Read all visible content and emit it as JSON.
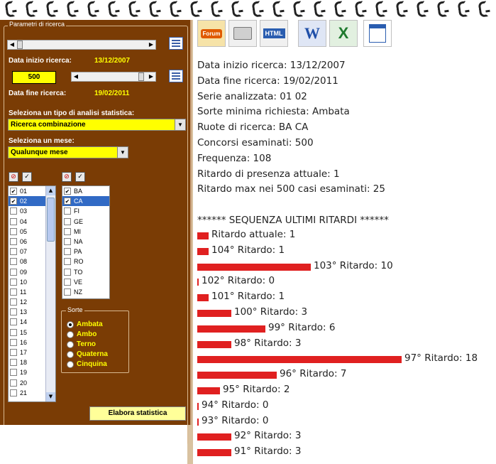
{
  "panel": {
    "legend": "Parametri di ricerca",
    "data_inizio_label": "Data inizio ricerca:",
    "data_inizio_value": "13/12/2007",
    "concorsi_value": "500",
    "data_fine_label": "Data fine ricerca:",
    "data_fine_value": "19/02/2011",
    "analisi_label": "Seleziona un tipo di analisi statistica:",
    "analisi_value": "Ricerca combinazione",
    "mese_label": "Seleziona un mese:",
    "mese_value": "Qualunque mese",
    "numbers": [
      {
        "label": "01",
        "checked": true,
        "selected": false
      },
      {
        "label": "02",
        "checked": true,
        "selected": true
      },
      {
        "label": "03",
        "checked": false,
        "selected": false
      },
      {
        "label": "04",
        "checked": false,
        "selected": false
      },
      {
        "label": "05",
        "checked": false,
        "selected": false
      },
      {
        "label": "06",
        "checked": false,
        "selected": false
      },
      {
        "label": "07",
        "checked": false,
        "selected": false
      },
      {
        "label": "08",
        "checked": false,
        "selected": false
      },
      {
        "label": "09",
        "checked": false,
        "selected": false
      },
      {
        "label": "10",
        "checked": false,
        "selected": false
      },
      {
        "label": "11",
        "checked": false,
        "selected": false
      },
      {
        "label": "12",
        "checked": false,
        "selected": false
      },
      {
        "label": "13",
        "checked": false,
        "selected": false
      },
      {
        "label": "14",
        "checked": false,
        "selected": false
      },
      {
        "label": "15",
        "checked": false,
        "selected": false
      },
      {
        "label": "16",
        "checked": false,
        "selected": false
      },
      {
        "label": "17",
        "checked": false,
        "selected": false
      },
      {
        "label": "18",
        "checked": false,
        "selected": false
      },
      {
        "label": "19",
        "checked": false,
        "selected": false
      },
      {
        "label": "20",
        "checked": false,
        "selected": false
      },
      {
        "label": "21",
        "checked": false,
        "selected": false
      }
    ],
    "ruote": [
      {
        "label": "BA",
        "checked": true,
        "selected": false
      },
      {
        "label": "CA",
        "checked": true,
        "selected": true
      },
      {
        "label": "FI",
        "checked": false,
        "selected": false
      },
      {
        "label": "GE",
        "checked": false,
        "selected": false
      },
      {
        "label": "MI",
        "checked": false,
        "selected": false
      },
      {
        "label": "NA",
        "checked": false,
        "selected": false
      },
      {
        "label": "PA",
        "checked": false,
        "selected": false
      },
      {
        "label": "RO",
        "checked": false,
        "selected": false
      },
      {
        "label": "TO",
        "checked": false,
        "selected": false
      },
      {
        "label": "VE",
        "checked": false,
        "selected": false
      },
      {
        "label": "NZ",
        "checked": false,
        "selected": false
      }
    ],
    "sorte_legend": "Sorte",
    "sorte": [
      {
        "label": "Ambata",
        "on": true
      },
      {
        "label": "Ambo",
        "on": false
      },
      {
        "label": "Terno",
        "on": false
      },
      {
        "label": "Quaterna",
        "on": false
      },
      {
        "label": "Cinquina",
        "on": false
      }
    ],
    "elabora_label": "Elabora statistica"
  },
  "toolbar": {
    "forum_label": "Forum",
    "html_label": "HTML",
    "word_label": "W",
    "excel_label": "X"
  },
  "results": {
    "lines": [
      "Data inizio ricerca: 13/12/2007",
      "Data fine ricerca: 19/02/2011",
      "Serie analizzata: 01 02",
      "Sorte minima richiesta: Ambata",
      "Ruote di ricerca: BA CA",
      "Concorsi esaminati: 500",
      "Frequenza: 108",
      "Ritardo di presenza attuale: 1",
      "Ritardo max nei 500 casi esaminati: 25",
      "",
      "****** SEQUENZA ULTIMI RITARDI ******"
    ],
    "ritardi": [
      {
        "label": "Ritardo attuale: 1",
        "value": 1
      },
      {
        "label": "104° Ritardo: 1",
        "value": 1
      },
      {
        "label": "103° Ritardo: 10",
        "value": 10
      },
      {
        "label": "102° Ritardo: 0",
        "value": 0
      },
      {
        "label": "101° Ritardo: 1",
        "value": 1
      },
      {
        "label": "100° Ritardo: 3",
        "value": 3
      },
      {
        "label": "99° Ritardo: 6",
        "value": 6
      },
      {
        "label": "98° Ritardo: 3",
        "value": 3
      },
      {
        "label": "97° Ritardo: 18",
        "value": 18
      },
      {
        "label": "96° Ritardo: 7",
        "value": 7
      },
      {
        "label": "95° Ritardo: 2",
        "value": 2
      },
      {
        "label": "94° Ritardo: 0",
        "value": 0
      },
      {
        "label": "93° Ritardo: 0",
        "value": 0
      },
      {
        "label": "92° Ritardo: 3",
        "value": 3
      },
      {
        "label": "91° Ritardo: 3",
        "value": 3
      }
    ]
  },
  "colors": {
    "panel_bg": "#7a3c05",
    "accent_yellow": "#ffff00",
    "bar_red": "#e02020",
    "selection_blue": "#316ac5"
  }
}
